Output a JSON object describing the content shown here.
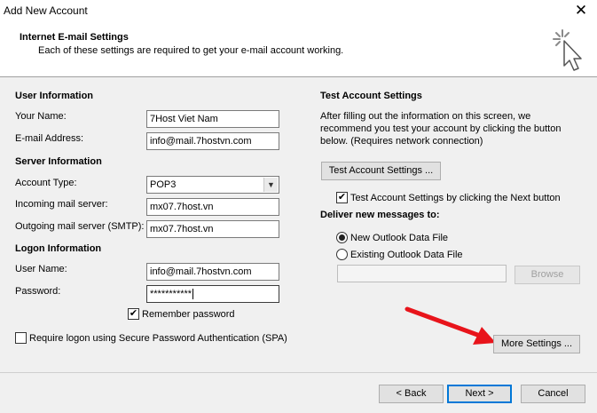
{
  "window": {
    "title": "Add New Account",
    "close_glyph": "✕"
  },
  "header": {
    "title": "Internet E-mail Settings",
    "subtitle": "Each of these settings are required to get your e-mail account working.",
    "icon": "cursor-click-icon"
  },
  "user_info": {
    "heading": "User Information",
    "name_label": "Your Name:",
    "name_value": "7Host Viet Nam",
    "email_label": "E-mail Address:",
    "email_value": "info@mail.7hostvn.com"
  },
  "server_info": {
    "heading": "Server Information",
    "account_type_label": "Account Type:",
    "account_type_value": "POP3",
    "incoming_label": "Incoming mail server:",
    "incoming_value": "mx07.7host.vn",
    "outgoing_label": "Outgoing mail server (SMTP):",
    "outgoing_value": "mx07.7host.vn"
  },
  "logon_info": {
    "heading": "Logon Information",
    "username_label": "User Name:",
    "username_value": "info@mail.7hostvn.com",
    "password_label": "Password:",
    "password_value": "***********",
    "remember_label": "Remember password",
    "remember_checked": true,
    "spa_label": "Require logon using Secure Password Authentication (SPA)",
    "spa_checked": false
  },
  "test_settings": {
    "heading": "Test Account Settings",
    "description_line1": "After filling out the information on this screen, we",
    "description_line2": "recommend you test your account by clicking the button",
    "description_line3": "below. (Requires network connection)",
    "test_button_label": "Test Account Settings ...",
    "test_on_next_label": "Test Account Settings by clicking the Next button",
    "test_on_next_checked": true
  },
  "deliver": {
    "heading": "Deliver new messages to:",
    "new_file_label": "New Outlook Data File",
    "existing_file_label": "Existing Outlook Data File",
    "selected": "new",
    "existing_path_value": "",
    "browse_label": "Browse"
  },
  "more_settings_label": "More Settings ...",
  "footer": {
    "back_label": "< Back",
    "next_label": "Next >",
    "cancel_label": "Cancel"
  },
  "colors": {
    "annotation_arrow": "#e8141b",
    "primary_border": "#0078d7"
  }
}
